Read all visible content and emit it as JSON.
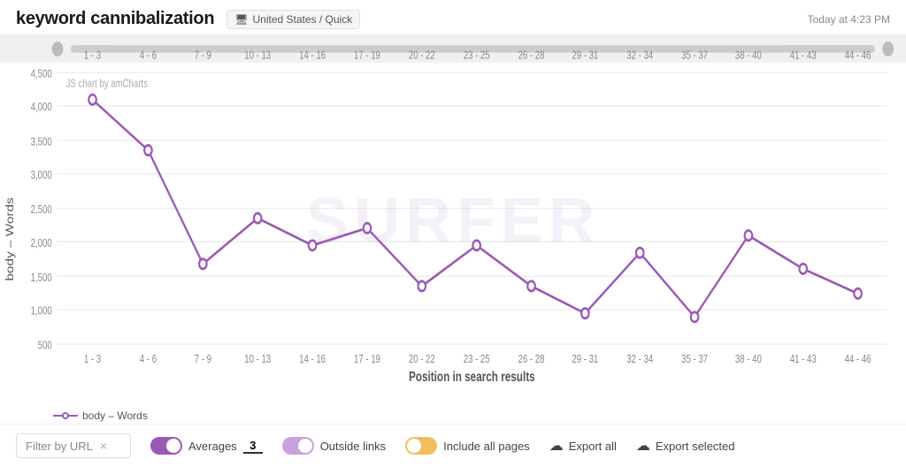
{
  "header": {
    "title": "keyword cannibalization",
    "location": "United States / Quick",
    "timestamp": "Today at 4:23 PM"
  },
  "chart": {
    "y_axis_label": "body – Words",
    "x_axis_label": "Position in search results",
    "amcharts_label": "JS chart by amCharts",
    "y_ticks": [
      "4,500",
      "4,000",
      "3,500",
      "3,000",
      "2,500",
      "2,000",
      "1,500",
      "1,000",
      "500"
    ],
    "x_labels": [
      "1 - 3",
      "4 - 6",
      "7 - 9",
      "10 - 13",
      "14 - 16",
      "17 - 19",
      "20 - 22",
      "23 - 25",
      "26 - 28",
      "29 - 31",
      "32 - 34",
      "35 - 37",
      "38 - 40",
      "41 - 43",
      "44 - 46"
    ],
    "series_label": "body – Words",
    "watermark": "SURFER"
  },
  "legend": {
    "label": "body – Words"
  },
  "toolbar": {
    "filter_placeholder": "Filter by URL",
    "filter_clear": "×",
    "averages_label": "Averages",
    "averages_value": "3",
    "outside_links_label": "Outside links",
    "include_all_pages_label": "Include all pages",
    "export_all_label": "Export all",
    "export_selected_label": "Export selected"
  }
}
